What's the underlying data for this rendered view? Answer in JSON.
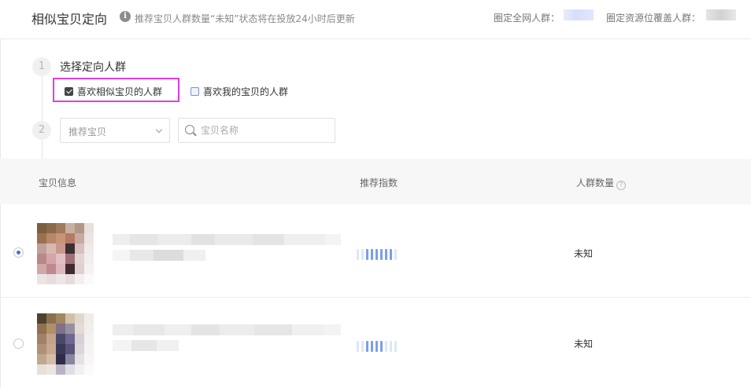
{
  "header": {
    "title": "相似宝贝定向",
    "notice": "推荐宝贝人群数量“未知”状态将在投放24小时后更新",
    "stat1_label": "圈定全网人群：",
    "stat2_label": "圈定资源位覆盖人群："
  },
  "step1": {
    "number": "1",
    "title": "选择定向人群",
    "options": [
      {
        "label": "喜欢相似宝贝的人群",
        "checked": true
      },
      {
        "label": "喜欢我的宝贝的人群",
        "checked": false
      }
    ]
  },
  "step2": {
    "number": "2",
    "select_label": "推荐宝贝",
    "search_placeholder": "宝贝名称"
  },
  "table": {
    "columns": [
      "宝贝信息",
      "推荐指数",
      "人群数量"
    ],
    "rows": [
      {
        "selected": true,
        "recommend_level": 6,
        "recommend_max": 9,
        "count": "未知"
      },
      {
        "selected": false,
        "recommend_level": 4,
        "recommend_max": 9,
        "count": "未知"
      }
    ]
  },
  "colors": {
    "highlight": "#e03ee0",
    "radio_active": "#3b73e8",
    "bar_active": "#7b9ee8",
    "bar_inactive": "#dce6f8"
  }
}
